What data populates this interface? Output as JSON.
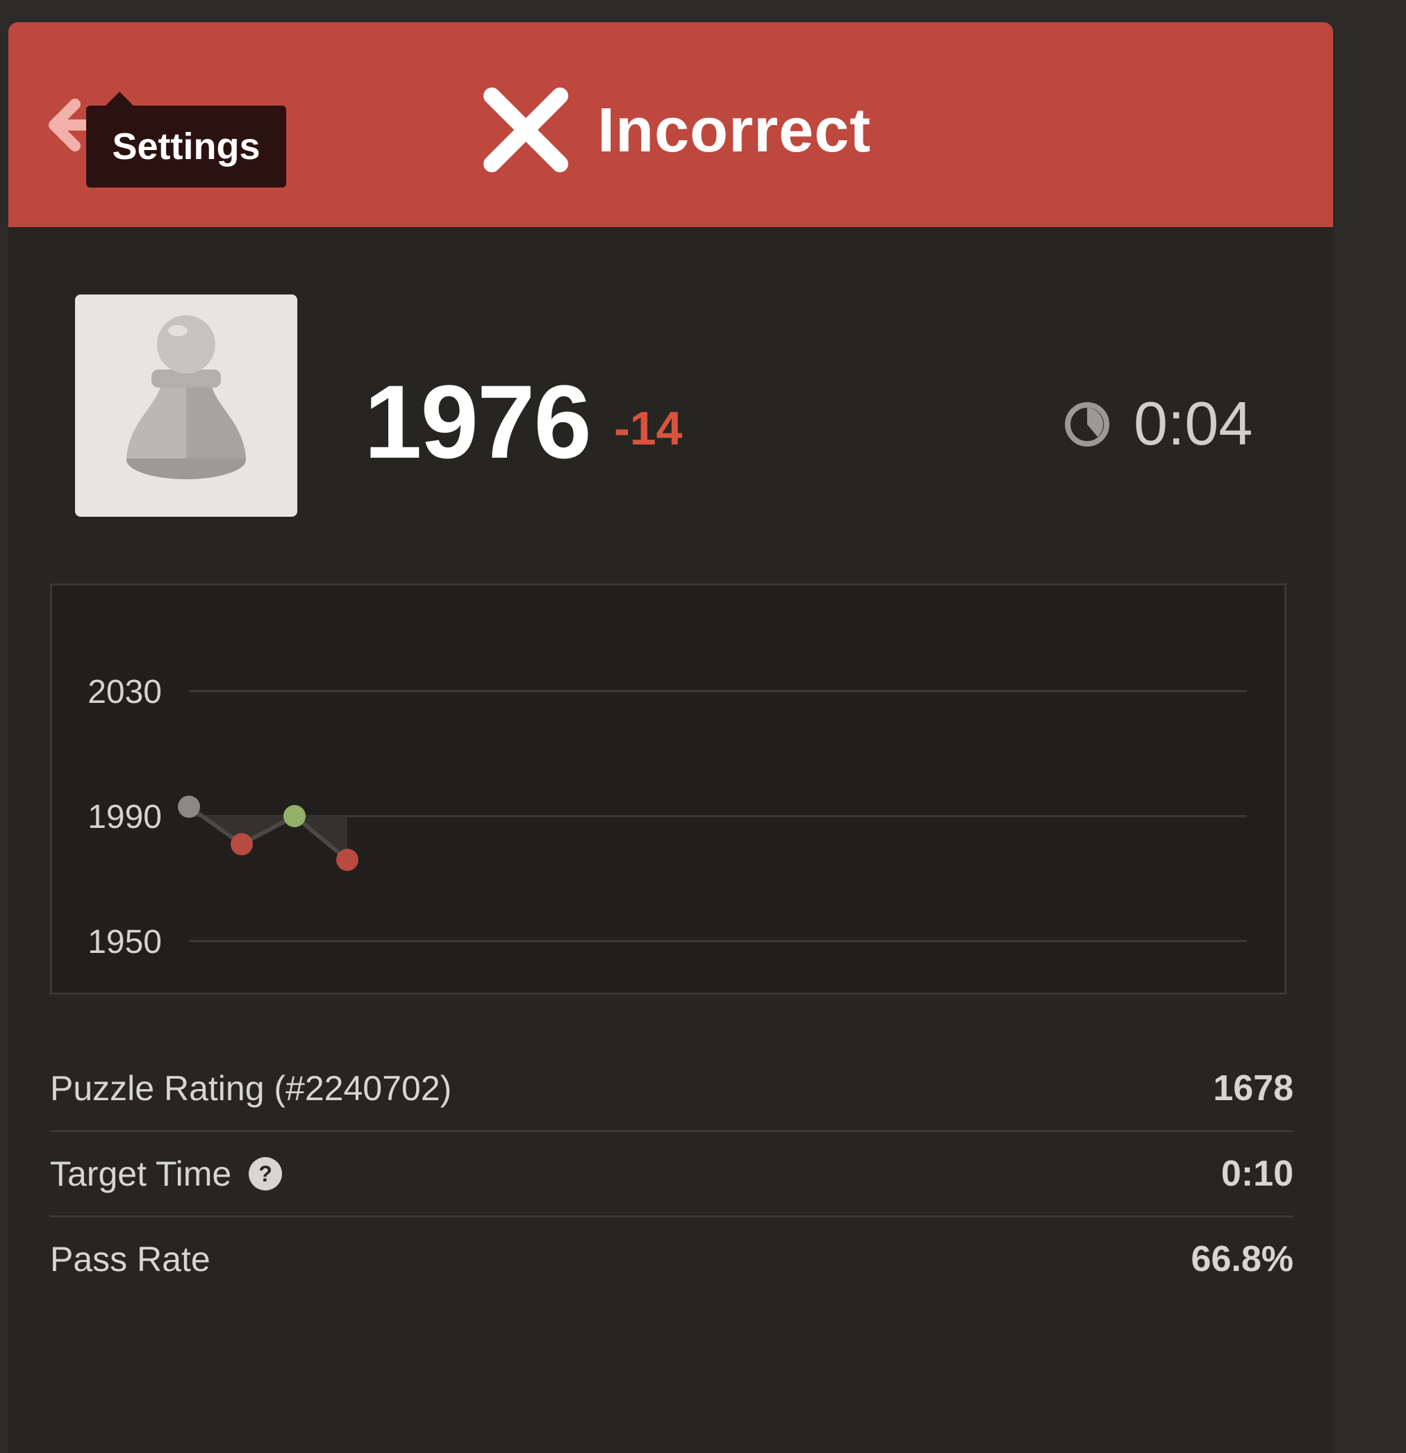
{
  "header": {
    "tooltip": "Settings",
    "status": "Incorrect",
    "colors": {
      "header_bg": "#bf483e",
      "tooltip_bg": "#2b1210"
    },
    "icons": {
      "back": "arrow-left-icon",
      "status": "x-icon"
    }
  },
  "player": {
    "avatar_icon": "pawn-icon",
    "rating": "1976",
    "rating_change": "-14",
    "timer": "0:04",
    "timer_icon": "clock-icon"
  },
  "chart_data": {
    "type": "line",
    "y_ticks": [
      "2030",
      "1990",
      "1950"
    ],
    "ylim": [
      1950,
      2030
    ],
    "x": [
      1,
      2,
      3,
      4
    ],
    "values": [
      1993,
      1981,
      1990,
      1976
    ],
    "point_colors": [
      "#8a8988",
      "#b84a40",
      "#94b067",
      "#b84a40"
    ],
    "grid": true
  },
  "stats": [
    {
      "label": "Puzzle Rating (#2240702)",
      "value": "1678"
    },
    {
      "label": "Target Time",
      "value": "0:10",
      "icon": "question-icon"
    },
    {
      "label": "Pass Rate",
      "value": "66.8%"
    }
  ]
}
